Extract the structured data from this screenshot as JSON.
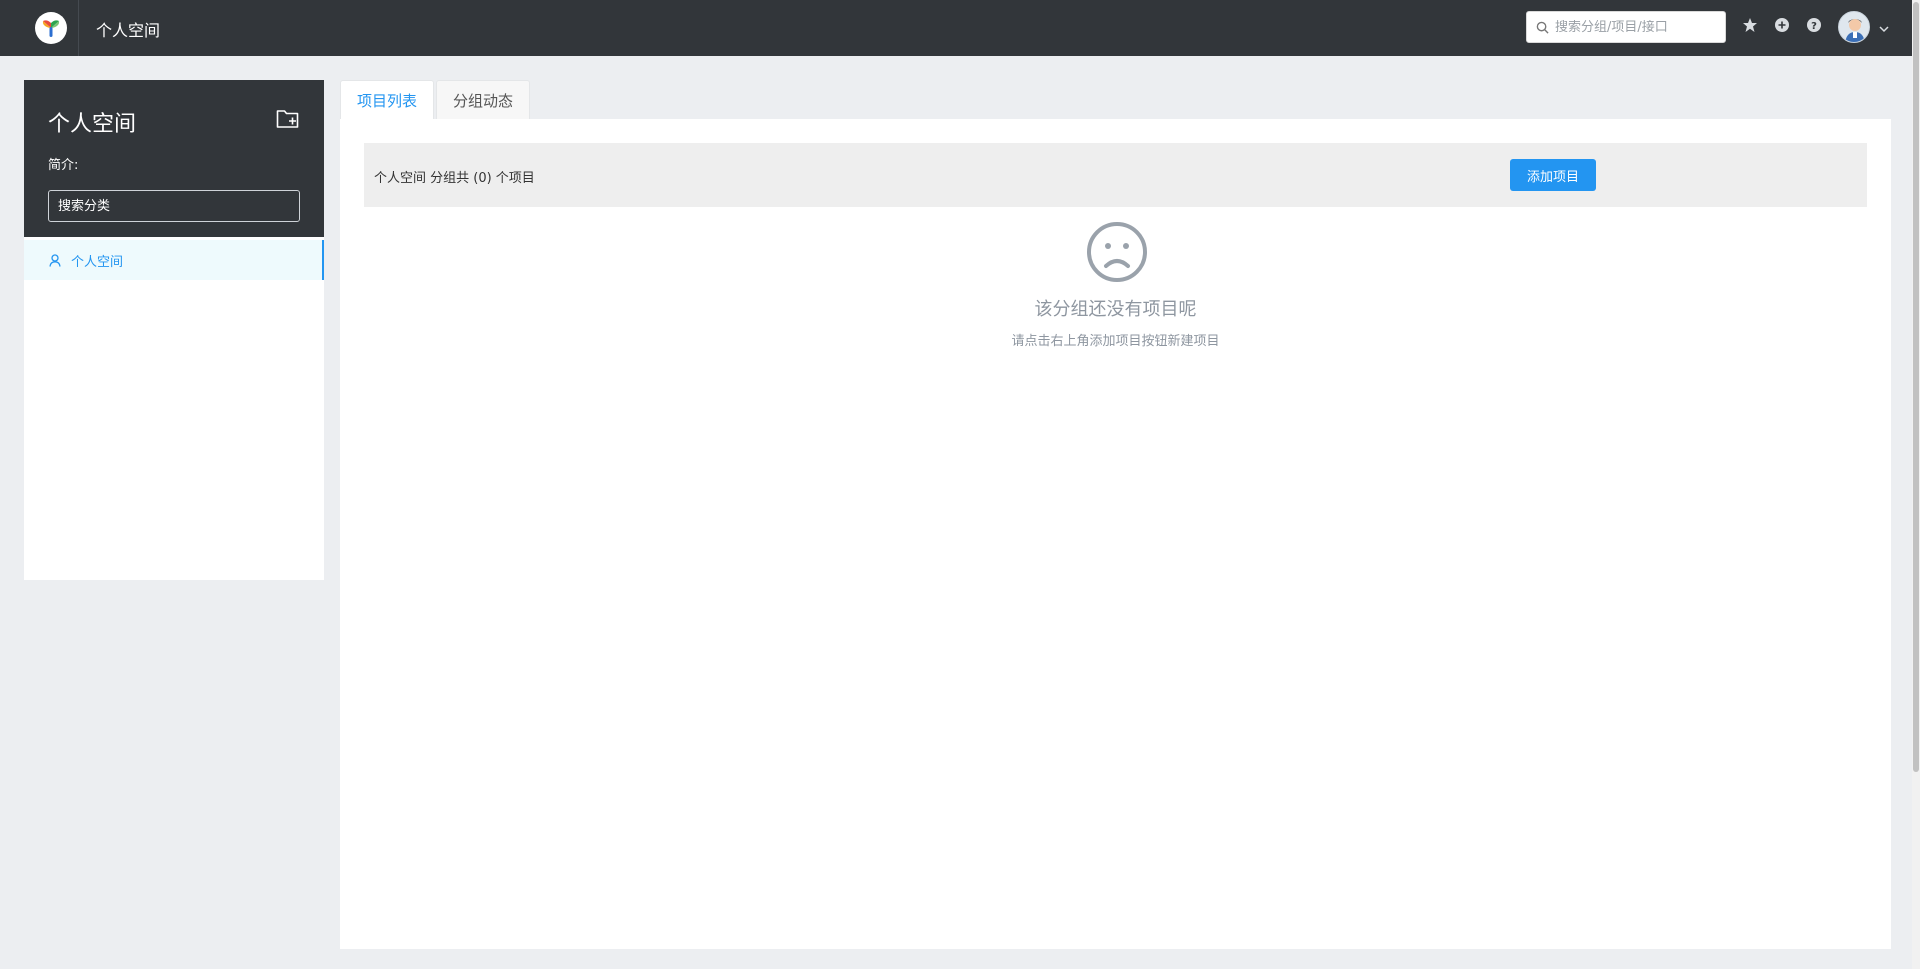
{
  "header": {
    "title": "个人空间",
    "search_placeholder": "搜索分组/项目/接口",
    "icons": [
      "logo-icon",
      "star-icon",
      "plus-circle-icon",
      "question-icon",
      "avatar",
      "chevron-down-icon"
    ]
  },
  "sidebar": {
    "title": "个人空间",
    "description_label": "简介:",
    "search_placeholder": "搜索分类",
    "items": [
      {
        "label": "个人空间",
        "icon": "user-icon",
        "active": true
      }
    ]
  },
  "tabs": [
    {
      "label": "项目列表",
      "active": true
    },
    {
      "label": "分组动态",
      "active": false
    }
  ],
  "main": {
    "info_text": "个人空间 分组共 (0) 个项目",
    "add_button": "添加项目",
    "empty_title": "该分组还没有项目呢",
    "empty_subtitle": "请点击右上角添加项目按钮新建项目"
  },
  "colors": {
    "accent": "#2395f1",
    "header_bg": "#32363a",
    "page_bg": "#eceef1",
    "muted": "#8e96a0"
  }
}
